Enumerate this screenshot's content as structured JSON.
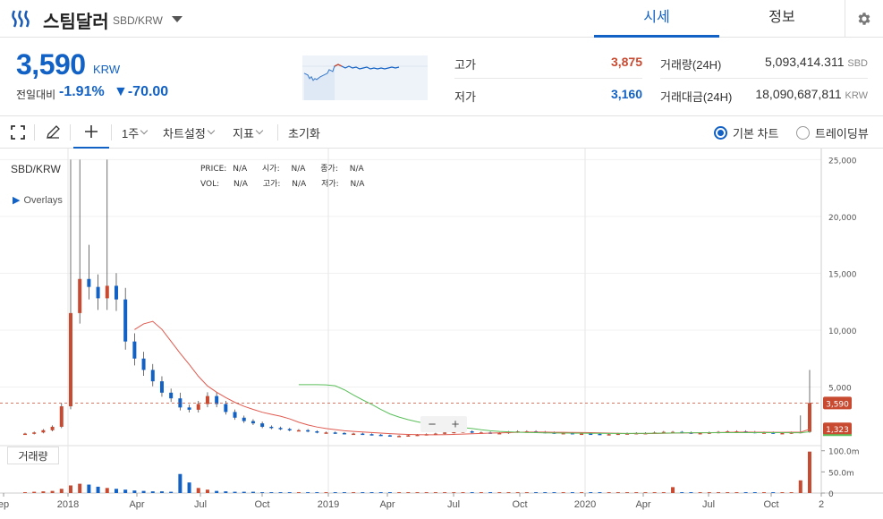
{
  "header": {
    "coin_name": "스팀달러",
    "pair": "SBD/KRW",
    "tabs": [
      {
        "label": "시세",
        "active": true
      },
      {
        "label": "정보",
        "active": false
      }
    ]
  },
  "price": {
    "current": "3,590",
    "unit": "KRW",
    "change_label": "전일대비",
    "change_rate": "-1.91%",
    "change_amount": "▼-70.00"
  },
  "stats": {
    "high_label": "고가",
    "high_value": "3,875",
    "low_label": "저가",
    "low_value": "3,160",
    "volume_label": "거래량(24H)",
    "volume_value": "5,093,414.311",
    "volume_unit": "SBD",
    "amount_label": "거래대금(24H)",
    "amount_value": "18,090,687,811",
    "amount_unit": "KRW"
  },
  "toolbar": {
    "interval": "1주",
    "chart_settings": "차트설정",
    "indicators": "지표",
    "reset": "초기화",
    "basic_chart": "기본 차트",
    "tradingview": "트레이딩뷰"
  },
  "chart_legend": {
    "symbol": "SBD/KRW",
    "overlays": "Overlays",
    "row1": [
      "PRICE:",
      "N/A",
      "시가:",
      "N/A",
      "종가:",
      "N/A"
    ],
    "row2": [
      "VOL:",
      "N/A",
      "고가:",
      "N/A",
      "저가:",
      "N/A"
    ]
  },
  "volume_label": "거래량",
  "colors": {
    "accent": "#1261c4",
    "up": "#c84a31",
    "down": "#1261c4",
    "ma_short": "#e05a4f",
    "ma_long": "#5bbf5b"
  },
  "chart_data": {
    "type": "candlestick",
    "y_ticks": [
      "25,000",
      "20,000",
      "15,000",
      "10,000",
      "5,000"
    ],
    "y_tick_values": [
      25000,
      20000,
      15000,
      10000,
      5000
    ],
    "vol_ticks": [
      "100.0m",
      "50.0m",
      "0"
    ],
    "vol_tick_values": [
      100,
      50,
      0
    ],
    "x_ticks": [
      "ep",
      "2018",
      "Apr",
      "Jul",
      "Oct",
      "2019",
      "Apr",
      "Jul",
      "Oct",
      "2020",
      "Apr",
      "Jul",
      "Oct",
      "2"
    ],
    "price_tag_current": "3,590",
    "price_tag_ma": "1,323",
    "ylim": [
      0,
      25500
    ],
    "candles_close": [
      900,
      1000,
      1200,
      1500,
      3300,
      11500,
      14500,
      13800,
      12800,
      13900,
      12700,
      9000,
      7500,
      6500,
      5500,
      4500,
      4000,
      3200,
      3000,
      3500,
      4200,
      3500,
      2800,
      2300,
      2000,
      1800,
      1500,
      1400,
      1300,
      1200,
      1200,
      1100,
      1000,
      1000,
      950,
      900,
      900,
      850,
      800,
      750,
      700,
      700,
      750,
      800,
      850,
      900,
      1000,
      1050,
      1100,
      1000,
      1000,
      950,
      950,
      1050,
      1100,
      1100,
      1050,
      1000,
      950,
      950,
      900,
      900,
      880,
      850,
      850,
      900,
      920,
      950,
      950,
      1000,
      1050,
      1050,
      1000,
      950,
      950,
      1000,
      1050,
      1100,
      1100,
      1050,
      1000,
      1000,
      950,
      950,
      1000,
      1050,
      3590
    ],
    "volume_m": [
      2,
      3,
      4,
      5,
      10,
      18,
      22,
      20,
      15,
      12,
      10,
      8,
      6,
      5,
      4,
      4,
      3,
      45,
      25,
      12,
      8,
      5,
      4,
      3,
      3,
      3,
      2,
      2,
      2,
      2,
      2,
      2,
      2,
      2,
      2,
      2,
      2,
      2,
      2,
      2,
      2,
      2,
      2,
      2,
      2,
      2,
      2,
      2,
      2,
      2,
      2,
      2,
      2,
      2,
      2,
      2,
      2,
      2,
      2,
      2,
      2,
      2,
      2,
      2,
      2,
      2,
      2,
      2,
      2,
      2,
      2,
      14,
      2,
      2,
      2,
      2,
      2,
      2,
      2,
      2,
      2,
      2,
      2,
      2,
      2,
      30,
      98
    ]
  }
}
